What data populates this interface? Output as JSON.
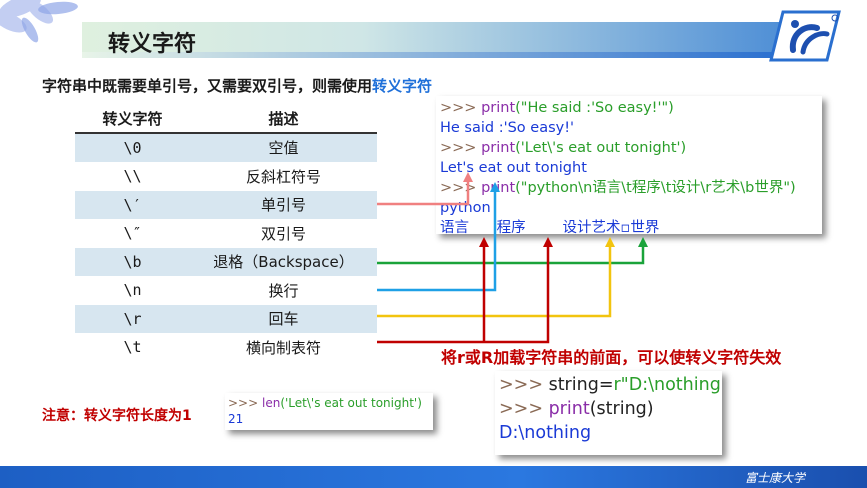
{
  "header": {
    "title": "转义字符"
  },
  "intro": {
    "text": "字符串中既需要单引号，又需要双引号，则需使用",
    "highlight": "转义字符"
  },
  "table": {
    "headers": [
      "转义字符",
      "描述"
    ],
    "rows": [
      [
        "\\0",
        "空值"
      ],
      [
        "\\\\",
        "反斜杠符号"
      ],
      [
        "\\′",
        "单引号"
      ],
      [
        "\\″",
        "双引号"
      ],
      [
        "\\b",
        "退格（Backspace）"
      ],
      [
        "\\n",
        "换行"
      ],
      [
        "\\r",
        "回车"
      ],
      [
        "\\t",
        "横向制表符"
      ]
    ]
  },
  "code_main": {
    "prompt": ">>>",
    "func": "print",
    "line1_arg": "(\"He said :'So easy!'\")",
    "out1": "He said :'So easy!'",
    "line2_arg": "('Let\\'s eat out tonight')",
    "out2": "Let's eat out tonight",
    "line3_arg": "(\"python\\n语言\\t程序\\t设计\\r艺术\\b世界\")",
    "out3a": "python",
    "out3b": "语言      程序        设计艺术▫世界"
  },
  "code_len": {
    "prompt": ">>>",
    "func": "len",
    "arg": "('Let\\'s eat out tonight')",
    "out": "21"
  },
  "code_raw": {
    "prompt": ">>>",
    "line1": "string=",
    "line1_str": "r\"D:\\nothing\"",
    "func": "print",
    "line2_arg": "(string)",
    "out": "D:\\nothing"
  },
  "note": {
    "text": "注意：转义字符长度为1"
  },
  "tip": {
    "text": "将r或R加载字符串的前面，可以使转义字符失效"
  },
  "footer": {
    "university": "富士康大学"
  },
  "colors": {
    "arrow_single_quote": "#f08080",
    "arrow_backspace": "#1aa33a",
    "arrow_newline": "#1ea0e6",
    "arrow_return": "#f2c40f",
    "arrow_tab": "#c00000"
  }
}
